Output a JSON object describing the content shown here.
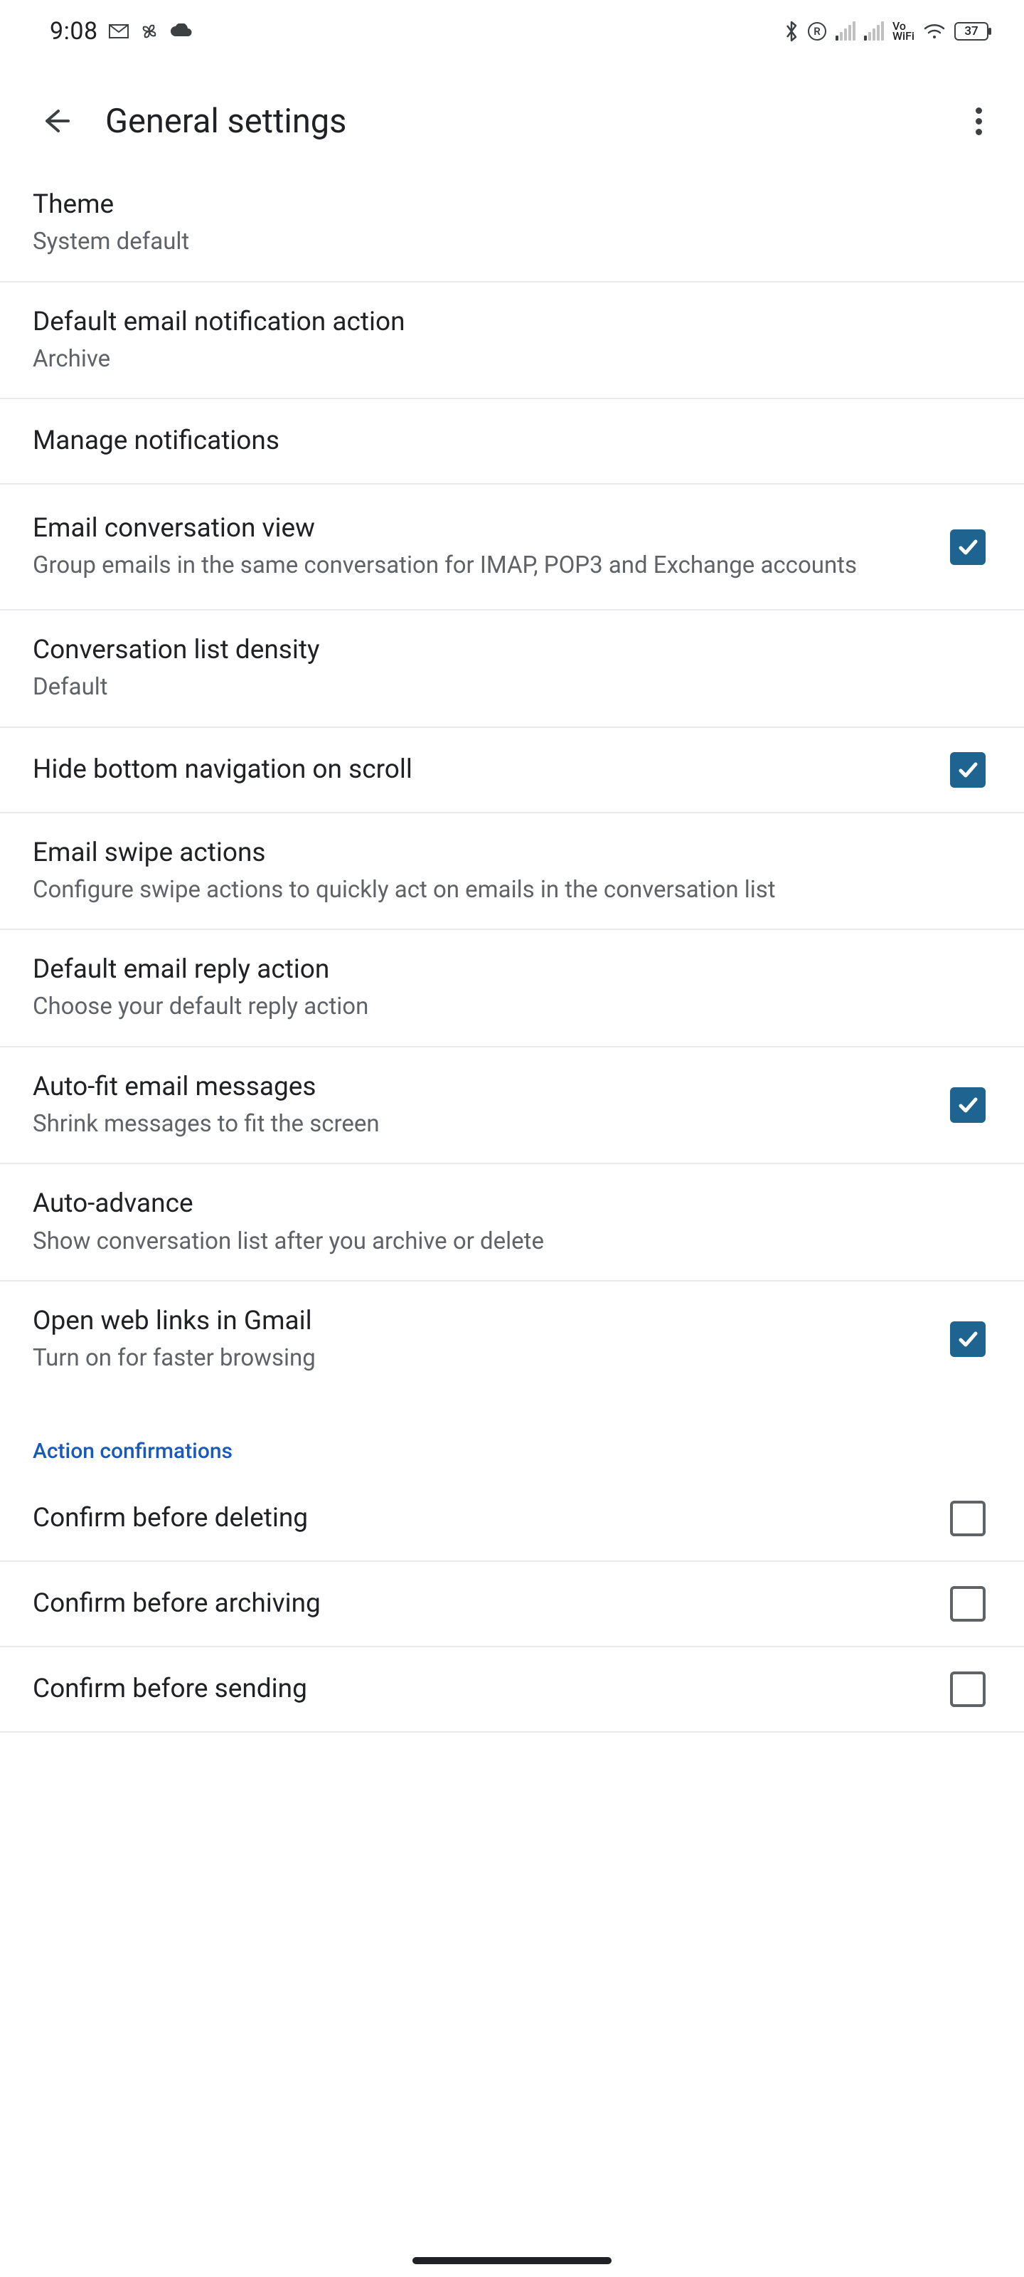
{
  "status": {
    "time": "9:08",
    "battery": "37"
  },
  "header": {
    "title": "General settings"
  },
  "items": [
    {
      "title": "Theme",
      "sub": "System default"
    },
    {
      "title": "Default email notification action",
      "sub": "Archive"
    },
    {
      "title": "Manage notifications"
    },
    {
      "title": "Email conversation view",
      "sub": "Group emails in the same conversation for IMAP, POP3 and Exchange accounts",
      "checked": true
    },
    {
      "title": "Conversation list density",
      "sub": "Default"
    },
    {
      "title": "Hide bottom navigation on scroll",
      "checked": true
    },
    {
      "title": "Email swipe actions",
      "sub": "Configure swipe actions to quickly act on emails in the conversation list"
    },
    {
      "title": "Default email reply action",
      "sub": "Choose your default reply action"
    },
    {
      "title": "Auto-fit email messages",
      "sub": "Shrink messages to fit the screen",
      "checked": true
    },
    {
      "title": "Auto-advance",
      "sub": "Show conversation list after you archive or delete"
    },
    {
      "title": "Open web links in Gmail",
      "sub": "Turn on for faster browsing",
      "checked": true
    }
  ],
  "section": {
    "label": "Action confirmations",
    "items": [
      {
        "title": "Confirm before deleting",
        "checked": false
      },
      {
        "title": "Confirm before archiving",
        "checked": false
      },
      {
        "title": "Confirm before sending",
        "checked": false
      }
    ]
  }
}
